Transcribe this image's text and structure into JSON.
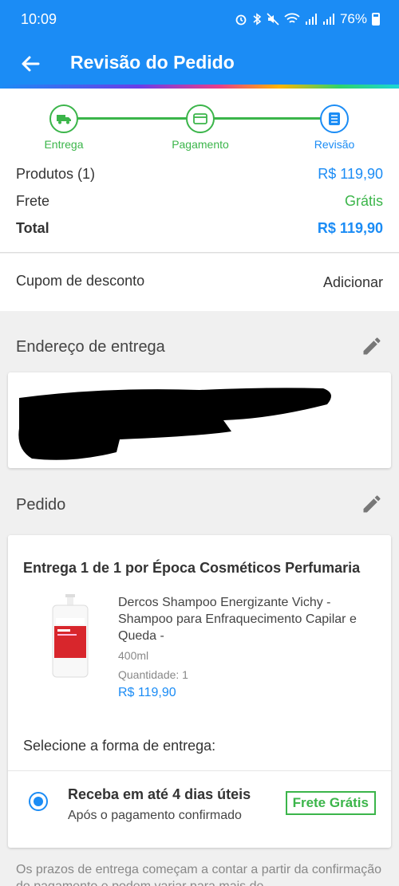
{
  "status_bar": {
    "time": "10:09",
    "battery": "76%"
  },
  "app_bar": {
    "title": "Revisão do Pedido"
  },
  "steps": [
    {
      "label": "Entrega"
    },
    {
      "label": "Pagamento"
    },
    {
      "label": "Revisão"
    }
  ],
  "summary": {
    "products_label": "Produtos (1)",
    "products_value": "R$ 119,90",
    "shipping_label": "Frete",
    "shipping_value": "Grátis",
    "total_label": "Total",
    "total_value": "R$ 119,90"
  },
  "coupon": {
    "label": "Cupom de desconto",
    "action": "Adicionar"
  },
  "address": {
    "title": "Endereço de entrega"
  },
  "order": {
    "title": "Pedido",
    "seller": "Entrega 1 de 1 por Época Cosméticos Perfumaria",
    "product": {
      "name": "Dercos Shampoo Energizante Vichy - Shampoo para Enfraquecimento Capilar e Queda -",
      "volume": "400ml",
      "quantity": "Quantidade:  1",
      "price": "R$ 119,90"
    },
    "shipping_title": "Selecione a forma de entrega:",
    "option": {
      "title": "Receba em até 4 dias úteis",
      "subtitle": "Após o pagamento confirmado",
      "badge": "Frete Grátis"
    }
  },
  "footer_note": "Os prazos de entrega começam a contar a partir da confirmação do pagamento e podem variar para mais de",
  "colors": {
    "primary": "#1b8cf5",
    "success": "#3bb54a"
  }
}
